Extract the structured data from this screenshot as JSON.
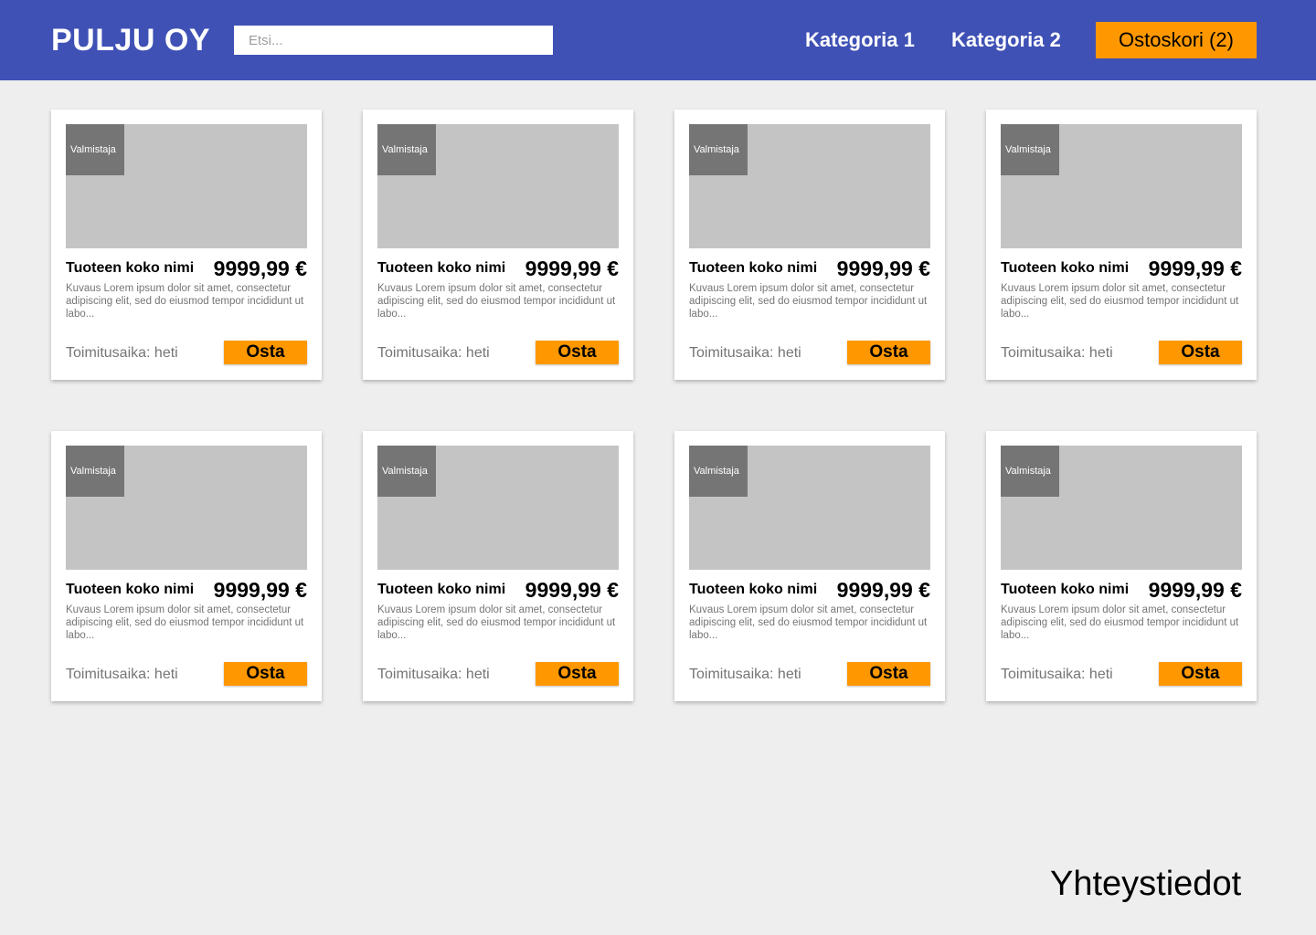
{
  "header": {
    "logo": "PULJU OY",
    "search_placeholder": "Etsi...",
    "nav": [
      "Kategoria 1",
      "Kategoria 2"
    ],
    "cart_label": "Ostoskori (2)"
  },
  "products": [
    {
      "maker": "Valmistaja",
      "name": "Tuoteen koko nimi",
      "price": "9999,99 €",
      "description": "Kuvaus Lorem ipsum dolor sit amet, consectetur adipiscing elit, sed do eiusmod tempor incididunt ut labo...",
      "delivery": "Toimitusaika: heti",
      "buy_label": "Osta"
    },
    {
      "maker": "Valmistaja",
      "name": "Tuoteen koko nimi",
      "price": "9999,99 €",
      "description": "Kuvaus Lorem ipsum dolor sit amet, consectetur adipiscing elit, sed do eiusmod tempor incididunt ut labo...",
      "delivery": "Toimitusaika: heti",
      "buy_label": "Osta"
    },
    {
      "maker": "Valmistaja",
      "name": "Tuoteen koko nimi",
      "price": "9999,99 €",
      "description": "Kuvaus Lorem ipsum dolor sit amet, consectetur adipiscing elit, sed do eiusmod tempor incididunt ut labo...",
      "delivery": "Toimitusaika: heti",
      "buy_label": "Osta"
    },
    {
      "maker": "Valmistaja",
      "name": "Tuoteen koko nimi",
      "price": "9999,99 €",
      "description": "Kuvaus Lorem ipsum dolor sit amet, consectetur adipiscing elit, sed do eiusmod tempor incididunt ut labo...",
      "delivery": "Toimitusaika: heti",
      "buy_label": "Osta"
    },
    {
      "maker": "Valmistaja",
      "name": "Tuoteen koko nimi",
      "price": "9999,99 €",
      "description": "Kuvaus Lorem ipsum dolor sit amet, consectetur adipiscing elit, sed do eiusmod tempor incididunt ut labo...",
      "delivery": "Toimitusaika: heti",
      "buy_label": "Osta"
    },
    {
      "maker": "Valmistaja",
      "name": "Tuoteen koko nimi",
      "price": "9999,99 €",
      "description": "Kuvaus Lorem ipsum dolor sit amet, consectetur adipiscing elit, sed do eiusmod tempor incididunt ut labo...",
      "delivery": "Toimitusaika: heti",
      "buy_label": "Osta"
    },
    {
      "maker": "Valmistaja",
      "name": "Tuoteen koko nimi",
      "price": "9999,99 €",
      "description": "Kuvaus Lorem ipsum dolor sit amet, consectetur adipiscing elit, sed do eiusmod tempor incididunt ut labo...",
      "delivery": "Toimitusaika: heti",
      "buy_label": "Osta"
    },
    {
      "maker": "Valmistaja",
      "name": "Tuoteen koko nimi",
      "price": "9999,99 €",
      "description": "Kuvaus Lorem ipsum dolor sit amet, consectetur adipiscing elit, sed do eiusmod tempor incididunt ut labo...",
      "delivery": "Toimitusaika: heti",
      "buy_label": "Osta"
    }
  ],
  "footer": {
    "contact_label": "Yhteystiedot"
  },
  "colors": {
    "header_bg": "#3f51b5",
    "accent": "#ff9800",
    "page_bg": "#eeeeee",
    "image_placeholder": "#c4c4c4",
    "maker_badge": "#757575"
  }
}
